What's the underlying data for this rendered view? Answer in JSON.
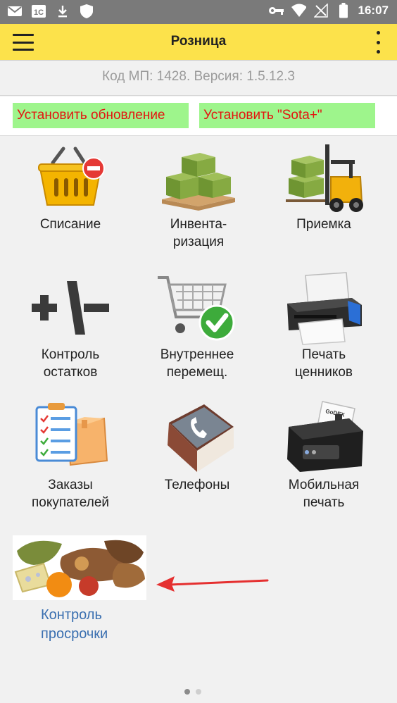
{
  "statusbar": {
    "time": "16:07",
    "icons_left": [
      "gmail-icon",
      "onec-icon",
      "download-icon",
      "shield-icon"
    ],
    "icons_right": [
      "key-icon",
      "wifi-icon",
      "no-signal-icon",
      "battery-icon"
    ],
    "onec_text": "1С"
  },
  "appbar": {
    "title": "Розница"
  },
  "version": {
    "text": "Код МП: 1428. Версия: 1.5.12.3"
  },
  "updates": {
    "install_update": "Установить обновление",
    "install_sota": "Установить \"Sota+\""
  },
  "menu": [
    {
      "line1": "Списание",
      "line2": ""
    },
    {
      "line1": "Инвента-",
      "line2": "ризация"
    },
    {
      "line1": "Приемка",
      "line2": ""
    },
    {
      "line1": "Контроль",
      "line2": "остатков"
    },
    {
      "line1": "Внутреннее",
      "line2": "перемещ."
    },
    {
      "line1": "Печать",
      "line2": "ценников"
    },
    {
      "line1": "Заказы",
      "line2": "покупателей"
    },
    {
      "line1": "Телефоны",
      "line2": ""
    },
    {
      "line1": "Мобильная",
      "line2": "печать"
    }
  ],
  "expiry": {
    "line1": "Контроль",
    "line2": "просрочки"
  },
  "printer_brand": "GoDEX",
  "colors": {
    "appbar": "#fce24b",
    "update_bg": "#9ef58c",
    "update_text": "#e4130f",
    "link": "#3a6fb0",
    "arrow": "#e53030"
  }
}
